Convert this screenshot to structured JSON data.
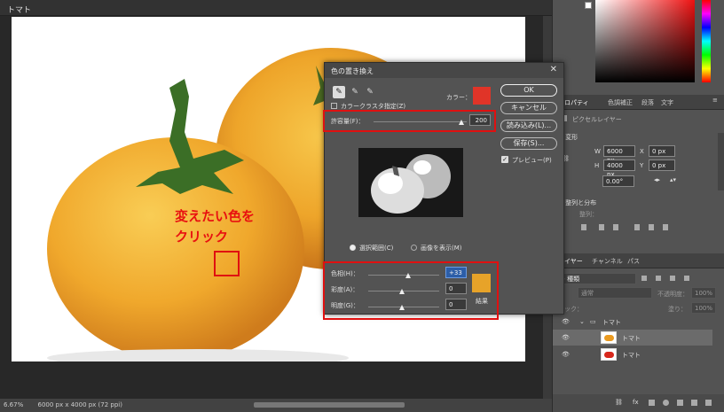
{
  "document": {
    "title": "トマト",
    "status_zoom": "6.67%",
    "status_info": "6000 px x 4000 px (72 ppi)"
  },
  "annotation": {
    "line1": "変えたい色を",
    "line2": "クリック"
  },
  "dialog": {
    "title": "色の置き換え",
    "localized_clusters": "カラークラスタ指定(Z)",
    "color_label": "カラー：",
    "selection_color": "#e03428",
    "fuzziness_label": "許容量(F)：",
    "fuzziness_value": "200",
    "radio_selection": "選択範囲(C)",
    "radio_image": "画像を表示(M)",
    "hue_label": "色相(H)：",
    "hue_value": "+33",
    "saturation_label": "彩度(A)：",
    "saturation_value": "0",
    "lightness_label": "明度(G)：",
    "lightness_value": "0",
    "result_label": "結果",
    "result_color": "#e7a329",
    "ok": "OK",
    "cancel": "キャンセル",
    "load": "読み込み(L)...",
    "save": "保存(S)...",
    "preview": "プレビュー(P)"
  },
  "properties": {
    "tabs": [
      "プロパティ",
      "色調補正",
      "段落",
      "文字"
    ],
    "layer_type": "ピクセルレイヤー",
    "transform": "変形",
    "w_label": "W",
    "w_value": "6000 px",
    "h_label": "H",
    "h_value": "4000 px",
    "x_label": "X",
    "x_value": "0 px",
    "y_label": "Y",
    "y_value": "0 px",
    "angle": "0.00°",
    "align": "整列と分布",
    "align_sub": "整列："
  },
  "layers": {
    "tabs": [
      "レイヤー",
      "チャンネル",
      "パス"
    ],
    "kind": "種類",
    "blend": "通常",
    "opacity_label": "不透明度：",
    "opacity_value": "100%",
    "lock_label": "ロック：",
    "fill_label": "塗り：",
    "fill_value": "100%",
    "group": "トマト",
    "items": [
      "トマト",
      "トマト"
    ]
  }
}
